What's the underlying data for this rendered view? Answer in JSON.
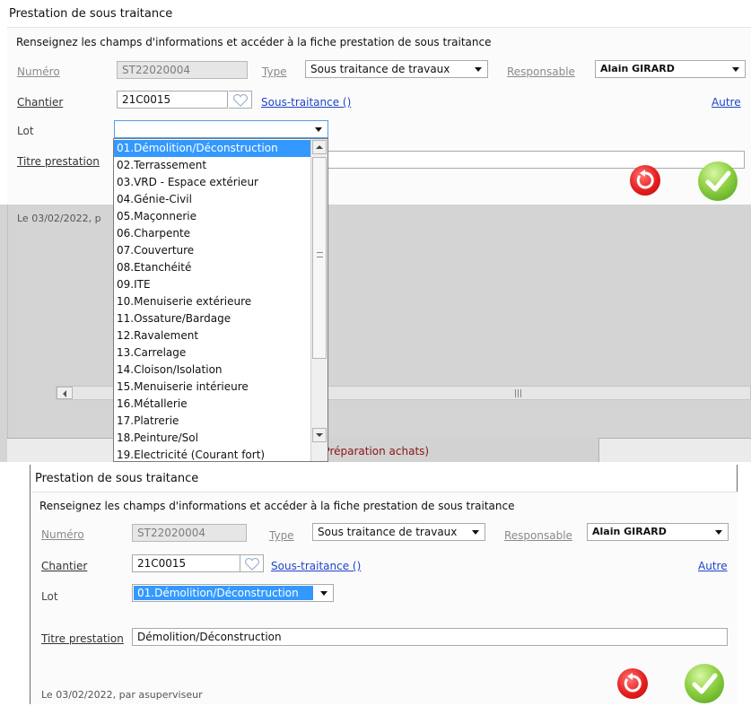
{
  "dialog_title": "Prestation de sous traitance",
  "instructions": "Renseignez les champs d'informations et accéder à la fiche prestation de sous traitance",
  "labels": {
    "numero": "Numéro",
    "type": "Type",
    "responsable": "Responsable",
    "chantier": "Chantier",
    "lot": "Lot",
    "titre": "Titre prestation"
  },
  "fields": {
    "numero": "ST22020004",
    "type": "Sous traitance de travaux",
    "responsable": "Alain GIRARD",
    "chantier": "21C0015",
    "sous_traitance_link": "Sous-traitance ()",
    "autre_link": "Autre",
    "lot_selected": "01.Démolition/Déconstruction",
    "titre": "Démolition/Déconstruction"
  },
  "footer_text": "Le 03/02/2022, par asuperviseur",
  "top_footer_fragment": "Le 03/02/2022, p",
  "bg_tab_fragment": "ils (Préparation achats)",
  "lot_options": [
    "01.Démolition/Déconstruction",
    "02.Terrassement",
    "03.VRD - Espace extérieur",
    "04.Génie-Civil",
    "05.Maçonnerie",
    "06.Charpente",
    "07.Couverture",
    "08.Etanchéité",
    "09.ITE",
    "10.Menuiserie extérieure",
    "11.Ossature/Bardage",
    "12.Ravalement",
    "13.Carrelage",
    "14.Cloison/Isolation",
    "15.Menuiserie intérieure",
    "16.Métallerie",
    "17.Platrerie",
    "18.Peinture/Sol",
    "19.Electricité (Courant fort)"
  ],
  "colors": {
    "link": "#1f44c8",
    "selection": "#3399ff",
    "cancel": "#e51f1f",
    "ok": "#8fd144",
    "bg_gray": "#d4d4d4"
  },
  "icons": {
    "cancel": "undo-arrow-icon",
    "ok": "checkmark-icon",
    "lookup": "heart-icon"
  }
}
